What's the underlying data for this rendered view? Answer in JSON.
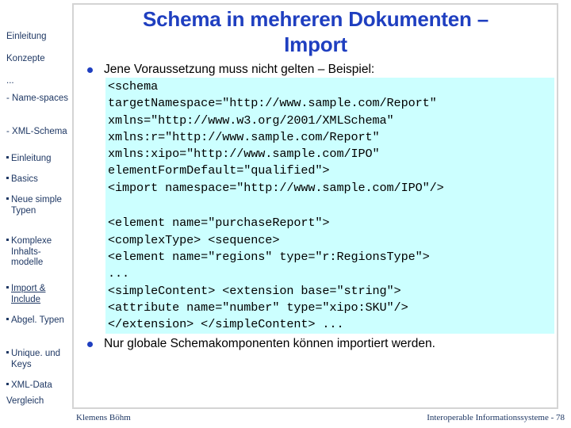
{
  "slide": {
    "title": "Schema in mehreren Dokumenten – Import",
    "title_line1": "Schema in mehreren Dokumenten –",
    "title_line2": "Import",
    "title_color": "#1f3fc0",
    "code_background_color": "#ccffff",
    "frame_border_color": "#d4d4d4"
  },
  "sidebar": {
    "items": [
      {
        "label": "Einleitung",
        "level": 0,
        "marker": "none",
        "active": false
      },
      {
        "label": "Konzepte",
        "level": 0,
        "marker": "none",
        "active": false
      },
      {
        "label": "...",
        "level": 1,
        "marker": "none",
        "active": false
      },
      {
        "label": "Name-spaces",
        "level": 1,
        "marker": "dash",
        "active": false
      },
      {
        "label": "XML-Schema",
        "level": 1,
        "marker": "dash",
        "active": false
      },
      {
        "label": "Einleitung",
        "level": 2,
        "marker": "square",
        "active": false
      },
      {
        "label": "Basics",
        "level": 2,
        "marker": "square",
        "active": false
      },
      {
        "label": "Neue simple Typen",
        "level": 2,
        "marker": "square",
        "active": false
      },
      {
        "label": "Komplexe Inhalts-modelle",
        "level": 2,
        "marker": "square",
        "active": false
      },
      {
        "label": "Import & Include",
        "level": 2,
        "marker": "square",
        "active": true
      },
      {
        "label": "Abgel. Typen",
        "level": 2,
        "marker": "square",
        "active": false
      },
      {
        "label": "Unique. und Keys",
        "level": 2,
        "marker": "square",
        "active": false
      },
      {
        "label": "XML-Data",
        "level": 2,
        "marker": "square",
        "active": false
      },
      {
        "label": "Vergleich",
        "level": 0,
        "marker": "none",
        "active": false
      }
    ]
  },
  "content": {
    "bullet1": "Jene Voraussetzung muss nicht gelten – Beispiel:",
    "code1": [
      "<schema",
      "targetNamespace=\"http://www.sample.com/Report\"",
      "xmlns=\"http://www.w3.org/2001/XMLSchema\"",
      "xmlns:r=\"http://www.sample.com/Report\"",
      "xmlns:xipo=\"http://www.sample.com/IPO\"",
      "elementFormDefault=\"qualified\">",
      "<import namespace=\"http://www.sample.com/IPO\"/>",
      ""
    ],
    "code2": [
      "<element name=\"purchaseReport\">",
      "<complexType> <sequence>",
      "<element name=\"regions\" type=\"r:RegionsType\">",
      "...",
      "<simpleContent> <extension base=\"string\">",
      "<attribute name=\"number\" type=\"xipo:SKU\"/>",
      "</extension> </simpleContent> ..."
    ],
    "bullet2": "Nur globale Schemakomponenten können importiert werden."
  },
  "footer": {
    "author": "Klemens Böhm",
    "course": "Interoperable Informationssysteme - 78"
  }
}
